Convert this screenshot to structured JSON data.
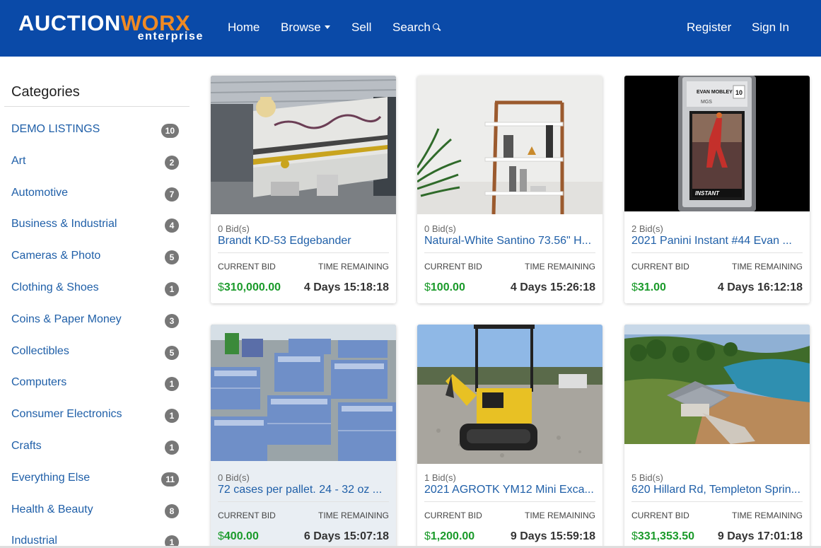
{
  "header": {
    "logo_main_1": "AUCTION",
    "logo_main_2": "WORX",
    "logo_sub": "enterprise",
    "nav": {
      "home": "Home",
      "browse": "Browse",
      "sell": "Sell",
      "search": "Search",
      "register": "Register",
      "signin": "Sign In"
    },
    "bg_color": "#0a4aa8",
    "accent_color": "#f08a24"
  },
  "sidebar": {
    "title": "Categories",
    "items": [
      {
        "label": "DEMO LISTINGS",
        "count": "10"
      },
      {
        "label": "Art",
        "count": "2"
      },
      {
        "label": "Automotive",
        "count": "7"
      },
      {
        "label": "Business & Industrial",
        "count": "4"
      },
      {
        "label": "Cameras & Photo",
        "count": "5"
      },
      {
        "label": "Clothing & Shoes",
        "count": "1"
      },
      {
        "label": "Coins & Paper Money",
        "count": "3"
      },
      {
        "label": "Collectibles",
        "count": "5"
      },
      {
        "label": "Computers",
        "count": "1"
      },
      {
        "label": "Consumer Electronics",
        "count": "1"
      },
      {
        "label": "Crafts",
        "count": "1"
      },
      {
        "label": "Everything Else",
        "count": "11"
      },
      {
        "label": "Health & Beauty",
        "count": "8"
      },
      {
        "label": "Industrial",
        "count": "1"
      }
    ]
  },
  "labels": {
    "current_bid": "CURRENT BID",
    "time_remaining": "TIME REMAINING"
  },
  "listings": [
    {
      "bids": "0 Bid(s)",
      "title": "Brandt KD-53 Edgebander",
      "currency": "$",
      "price": "310,000.00",
      "time": "4 Days 15:18:18"
    },
    {
      "bids": "0 Bid(s)",
      "title": "Natural-White Santino 73.56\" H...",
      "currency": "$",
      "price": "100.00",
      "time": "4 Days 15:26:18"
    },
    {
      "bids": "2 Bid(s)",
      "title": "2021 Panini Instant #44 Evan ...",
      "currency": "$",
      "price": "31.00",
      "time": "4 Days 16:12:18"
    },
    {
      "bids": "0 Bid(s)",
      "title": "72 cases per pallet. 24 - 32 oz ...",
      "currency": "$",
      "price": "400.00",
      "time": "6 Days 15:07:18"
    },
    {
      "bids": "1 Bid(s)",
      "title": "2021 AGROTK YM12 Mini Exca...",
      "currency": "$",
      "price": "1,200.00",
      "time": "9 Days 15:59:18"
    },
    {
      "bids": "5 Bid(s)",
      "title": "620 Hillard Rd, Templeton Sprin...",
      "currency": "$",
      "price": "331,353.50",
      "time": "9 Days 17:01:18"
    }
  ],
  "card_label_text": {
    "card_label": "EVAN MOBLEY",
    "grade": "10",
    "brand": "MGS",
    "player_name": "INSTANT"
  }
}
